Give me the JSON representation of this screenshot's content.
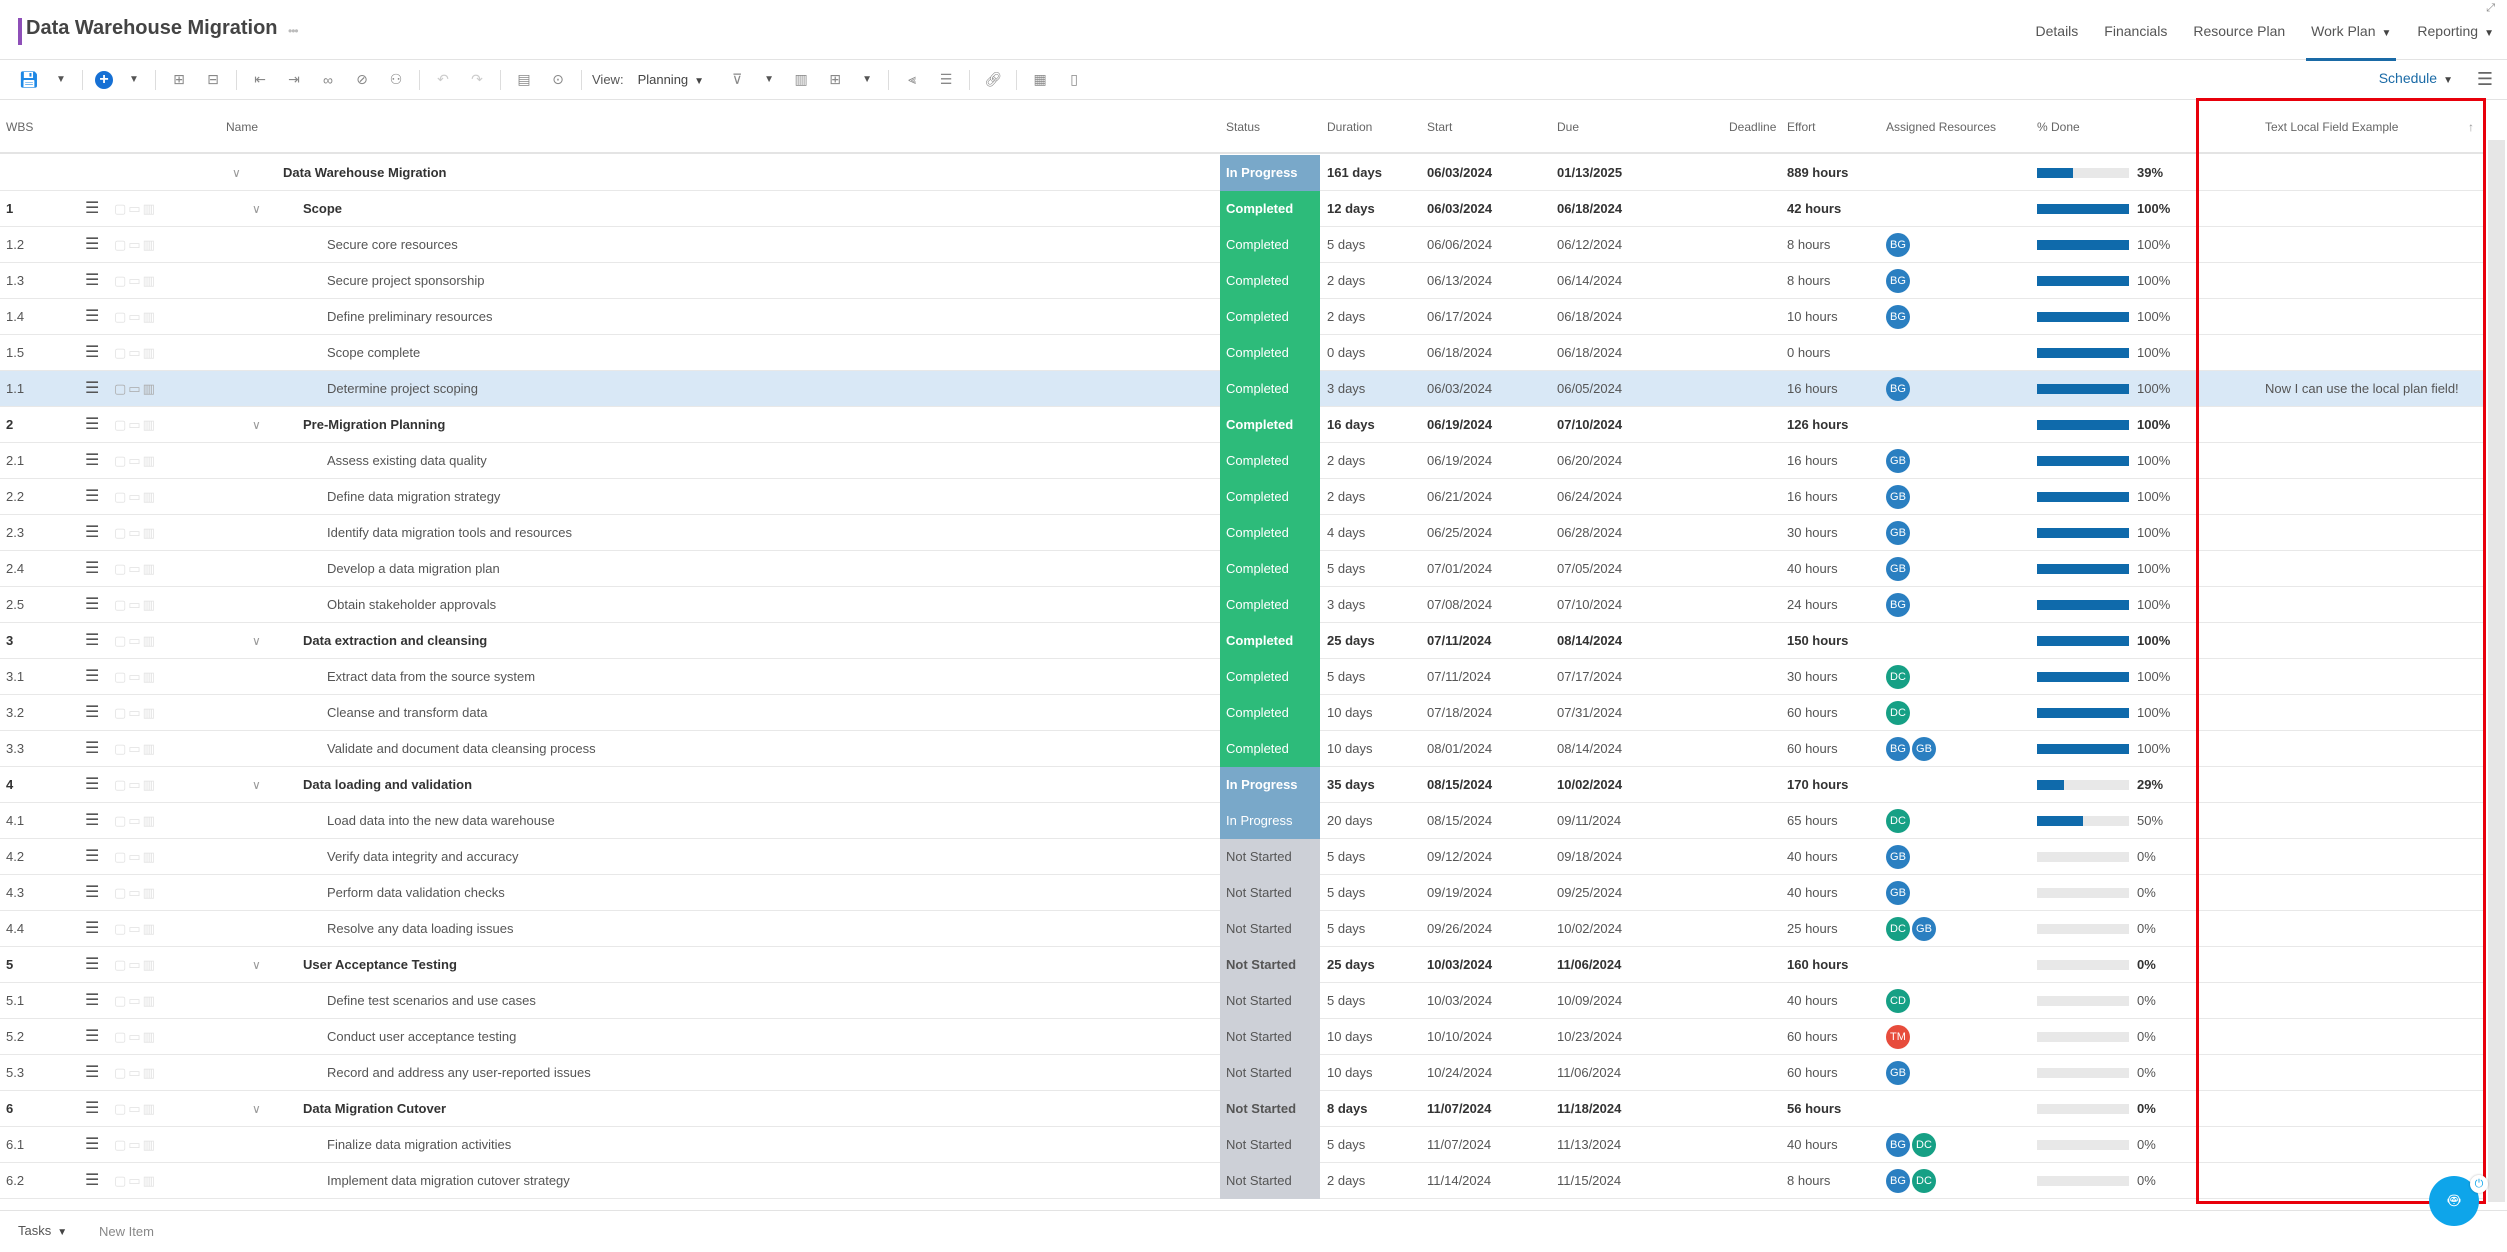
{
  "header": {
    "title": "Data Warehouse Migration",
    "more_icon": "ellipsis-icon",
    "accent_color": "#8e4fb8",
    "nav": [
      {
        "label": "Details",
        "active": false,
        "dropdown": false
      },
      {
        "label": "Financials",
        "active": false,
        "dropdown": false
      },
      {
        "label": "Resource Plan",
        "active": false,
        "dropdown": false
      },
      {
        "label": "Work Plan",
        "active": true,
        "dropdown": true
      },
      {
        "label": "Reporting",
        "active": false,
        "dropdown": true
      }
    ]
  },
  "toolbar": {
    "view_label": "View:",
    "view_value": "Planning",
    "schedule_label": "Schedule"
  },
  "columns": {
    "wbs": "WBS",
    "name": "Name",
    "status": "Status",
    "duration": "Duration",
    "start": "Start",
    "due": "Due",
    "deadline": "Deadline",
    "effort": "Effort",
    "resources": "Assigned Resources",
    "pct_done": "% Done",
    "local_field": "Text Local Field Example"
  },
  "status_colors": {
    "Completed": "#2dbb7a",
    "In Progress": "#79a8c9",
    "Not Started": "#cdd0d7"
  },
  "avatar_colors": {
    "BG": "#2a7fc1",
    "GB": "#2a7fc1",
    "DC": "#16a085",
    "CD": "#16a085",
    "TM": "#e74c3c"
  },
  "rows": [
    {
      "wbs": "",
      "name": "Data Warehouse Migration",
      "level": 0,
      "summary": true,
      "status": "In Progress",
      "duration": "161 days",
      "start": "06/03/2024",
      "due": "01/13/2025",
      "effort": "889 hours",
      "resources": [],
      "pct": 39,
      "pct_label": "39%",
      "local": ""
    },
    {
      "wbs": "1",
      "name": "Scope",
      "level": 1,
      "summary": true,
      "status": "Completed",
      "duration": "12 days",
      "start": "06/03/2024",
      "due": "06/18/2024",
      "effort": "42 hours",
      "resources": [],
      "pct": 100,
      "pct_label": "100%",
      "local": ""
    },
    {
      "wbs": "1.2",
      "name": "Secure core resources",
      "level": 2,
      "summary": false,
      "status": "Completed",
      "duration": "5 days",
      "start": "06/06/2024",
      "due": "06/12/2024",
      "effort": "8 hours",
      "resources": [
        "BG"
      ],
      "pct": 100,
      "pct_label": "100%",
      "local": ""
    },
    {
      "wbs": "1.3",
      "name": "Secure project sponsorship",
      "level": 2,
      "summary": false,
      "status": "Completed",
      "duration": "2 days",
      "start": "06/13/2024",
      "due": "06/14/2024",
      "effort": "8 hours",
      "resources": [
        "BG"
      ],
      "pct": 100,
      "pct_label": "100%",
      "local": ""
    },
    {
      "wbs": "1.4",
      "name": "Define preliminary resources",
      "level": 2,
      "summary": false,
      "status": "Completed",
      "duration": "2 days",
      "start": "06/17/2024",
      "due": "06/18/2024",
      "effort": "10 hours",
      "resources": [
        "BG"
      ],
      "pct": 100,
      "pct_label": "100%",
      "local": ""
    },
    {
      "wbs": "1.5",
      "name": "Scope complete",
      "level": 2,
      "summary": false,
      "status": "Completed",
      "duration": "0 days",
      "start": "06/18/2024",
      "due": "06/18/2024",
      "effort": "0 hours",
      "resources": [],
      "pct": 100,
      "pct_label": "100%",
      "local": ""
    },
    {
      "wbs": "1.1",
      "name": "Determine project scoping",
      "level": 2,
      "summary": false,
      "selected": true,
      "status": "Completed",
      "duration": "3 days",
      "start": "06/03/2024",
      "due": "06/05/2024",
      "effort": "16 hours",
      "resources": [
        "BG"
      ],
      "pct": 100,
      "pct_label": "100%",
      "local": "Now I can use the local plan field!"
    },
    {
      "wbs": "2",
      "name": "Pre-Migration Planning",
      "level": 1,
      "summary": true,
      "status": "Completed",
      "duration": "16 days",
      "start": "06/19/2024",
      "due": "07/10/2024",
      "effort": "126 hours",
      "resources": [],
      "pct": 100,
      "pct_label": "100%",
      "local": ""
    },
    {
      "wbs": "2.1",
      "name": "Assess existing data quality",
      "level": 2,
      "summary": false,
      "status": "Completed",
      "duration": "2 days",
      "start": "06/19/2024",
      "due": "06/20/2024",
      "effort": "16 hours",
      "resources": [
        "GB"
      ],
      "pct": 100,
      "pct_label": "100%",
      "local": ""
    },
    {
      "wbs": "2.2",
      "name": "Define data migration strategy",
      "level": 2,
      "summary": false,
      "status": "Completed",
      "duration": "2 days",
      "start": "06/21/2024",
      "due": "06/24/2024",
      "effort": "16 hours",
      "resources": [
        "GB"
      ],
      "pct": 100,
      "pct_label": "100%",
      "local": ""
    },
    {
      "wbs": "2.3",
      "name": "Identify data migration tools and resources",
      "level": 2,
      "summary": false,
      "status": "Completed",
      "duration": "4 days",
      "start": "06/25/2024",
      "due": "06/28/2024",
      "effort": "30 hours",
      "resources": [
        "GB"
      ],
      "pct": 100,
      "pct_label": "100%",
      "local": ""
    },
    {
      "wbs": "2.4",
      "name": "Develop a data migration plan",
      "level": 2,
      "summary": false,
      "status": "Completed",
      "duration": "5 days",
      "start": "07/01/2024",
      "due": "07/05/2024",
      "effort": "40 hours",
      "resources": [
        "GB"
      ],
      "pct": 100,
      "pct_label": "100%",
      "local": ""
    },
    {
      "wbs": "2.5",
      "name": "Obtain stakeholder approvals",
      "level": 2,
      "summary": false,
      "status": "Completed",
      "duration": "3 days",
      "start": "07/08/2024",
      "due": "07/10/2024",
      "effort": "24 hours",
      "resources": [
        "BG"
      ],
      "pct": 100,
      "pct_label": "100%",
      "local": ""
    },
    {
      "wbs": "3",
      "name": "Data extraction and cleansing",
      "level": 1,
      "summary": true,
      "status": "Completed",
      "duration": "25 days",
      "start": "07/11/2024",
      "due": "08/14/2024",
      "effort": "150 hours",
      "resources": [],
      "pct": 100,
      "pct_label": "100%",
      "local": ""
    },
    {
      "wbs": "3.1",
      "name": "Extract data from the source system",
      "level": 2,
      "summary": false,
      "status": "Completed",
      "duration": "5 days",
      "start": "07/11/2024",
      "due": "07/17/2024",
      "effort": "30 hours",
      "resources": [
        "DC"
      ],
      "pct": 100,
      "pct_label": "100%",
      "local": ""
    },
    {
      "wbs": "3.2",
      "name": "Cleanse and transform data",
      "level": 2,
      "summary": false,
      "status": "Completed",
      "duration": "10 days",
      "start": "07/18/2024",
      "due": "07/31/2024",
      "effort": "60 hours",
      "resources": [
        "DC"
      ],
      "pct": 100,
      "pct_label": "100%",
      "local": ""
    },
    {
      "wbs": "3.3",
      "name": "Validate and document data cleansing process",
      "level": 2,
      "summary": false,
      "status": "Completed",
      "duration": "10 days",
      "start": "08/01/2024",
      "due": "08/14/2024",
      "effort": "60 hours",
      "resources": [
        "BG",
        "GB"
      ],
      "pct": 100,
      "pct_label": "100%",
      "local": ""
    },
    {
      "wbs": "4",
      "name": "Data loading and validation",
      "level": 1,
      "summary": true,
      "status": "In Progress",
      "duration": "35 days",
      "start": "08/15/2024",
      "due": "10/02/2024",
      "effort": "170 hours",
      "resources": [],
      "pct": 29,
      "pct_label": "29%",
      "local": ""
    },
    {
      "wbs": "4.1",
      "name": "Load data into the new data warehouse",
      "level": 2,
      "summary": false,
      "status": "In Progress",
      "duration": "20 days",
      "start": "08/15/2024",
      "due": "09/11/2024",
      "effort": "65 hours",
      "resources": [
        "DC"
      ],
      "pct": 50,
      "pct_label": "50%",
      "local": ""
    },
    {
      "wbs": "4.2",
      "name": "Verify data integrity and accuracy",
      "level": 2,
      "summary": false,
      "status": "Not Started",
      "duration": "5 days",
      "start": "09/12/2024",
      "due": "09/18/2024",
      "effort": "40 hours",
      "resources": [
        "GB"
      ],
      "pct": 0,
      "pct_label": "0%",
      "local": ""
    },
    {
      "wbs": "4.3",
      "name": "Perform data validation checks",
      "level": 2,
      "summary": false,
      "status": "Not Started",
      "duration": "5 days",
      "start": "09/19/2024",
      "due": "09/25/2024",
      "effort": "40 hours",
      "resources": [
        "GB"
      ],
      "pct": 0,
      "pct_label": "0%",
      "local": ""
    },
    {
      "wbs": "4.4",
      "name": "Resolve any data loading issues",
      "level": 2,
      "summary": false,
      "status": "Not Started",
      "duration": "5 days",
      "start": "09/26/2024",
      "due": "10/02/2024",
      "effort": "25 hours",
      "resources": [
        "DC",
        "GB"
      ],
      "pct": 0,
      "pct_label": "0%",
      "local": ""
    },
    {
      "wbs": "5",
      "name": "User Acceptance Testing",
      "level": 1,
      "summary": true,
      "status": "Not Started",
      "duration": "25 days",
      "start": "10/03/2024",
      "due": "11/06/2024",
      "effort": "160 hours",
      "resources": [],
      "pct": 0,
      "pct_label": "0%",
      "local": ""
    },
    {
      "wbs": "5.1",
      "name": "Define test scenarios and use cases",
      "level": 2,
      "summary": false,
      "status": "Not Started",
      "duration": "5 days",
      "start": "10/03/2024",
      "due": "10/09/2024",
      "effort": "40 hours",
      "resources": [
        "CD"
      ],
      "pct": 0,
      "pct_label": "0%",
      "local": ""
    },
    {
      "wbs": "5.2",
      "name": "Conduct user acceptance testing",
      "level": 2,
      "summary": false,
      "status": "Not Started",
      "duration": "10 days",
      "start": "10/10/2024",
      "due": "10/23/2024",
      "effort": "60 hours",
      "resources": [
        "TM"
      ],
      "pct": 0,
      "pct_label": "0%",
      "local": ""
    },
    {
      "wbs": "5.3",
      "name": "Record and address any user-reported issues",
      "level": 2,
      "summary": false,
      "status": "Not Started",
      "duration": "10 days",
      "start": "10/24/2024",
      "due": "11/06/2024",
      "effort": "60 hours",
      "resources": [
        "GB"
      ],
      "pct": 0,
      "pct_label": "0%",
      "local": ""
    },
    {
      "wbs": "6",
      "name": "Data Migration Cutover",
      "level": 1,
      "summary": true,
      "status": "Not Started",
      "duration": "8 days",
      "start": "11/07/2024",
      "due": "11/18/2024",
      "effort": "56 hours",
      "resources": [],
      "pct": 0,
      "pct_label": "0%",
      "local": ""
    },
    {
      "wbs": "6.1",
      "name": "Finalize data migration activities",
      "level": 2,
      "summary": false,
      "status": "Not Started",
      "duration": "5 days",
      "start": "11/07/2024",
      "due": "11/13/2024",
      "effort": "40 hours",
      "resources": [
        "BG",
        "DC"
      ],
      "pct": 0,
      "pct_label": "0%",
      "local": ""
    },
    {
      "wbs": "6.2",
      "name": "Implement data migration cutover strategy",
      "level": 2,
      "summary": false,
      "status": "Not Started",
      "duration": "2 days",
      "start": "11/14/2024",
      "due": "11/15/2024",
      "effort": "8 hours",
      "resources": [
        "BG",
        "DC"
      ],
      "pct": 0,
      "pct_label": "0%",
      "local": ""
    }
  ],
  "footer": {
    "tasks_label": "Tasks",
    "new_item_label": "New Item"
  }
}
